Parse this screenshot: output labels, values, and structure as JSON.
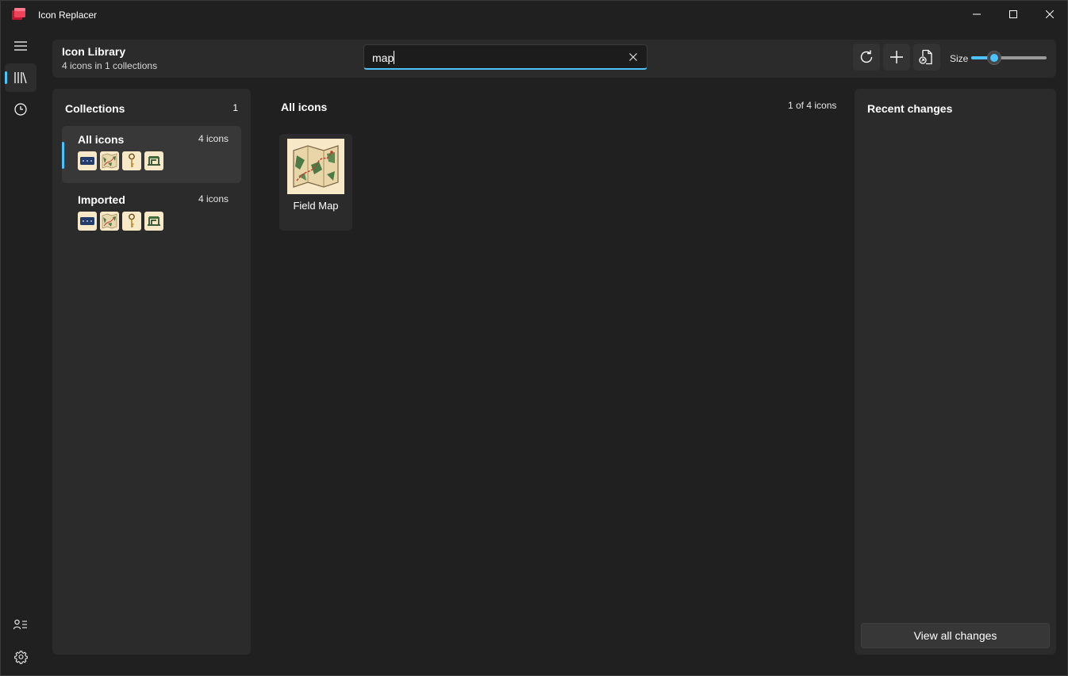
{
  "window": {
    "title": "Icon Replacer"
  },
  "header": {
    "title": "Icon Library",
    "subtitle": "4 icons in 1 collections",
    "search": {
      "value": "map",
      "placeholder": ""
    },
    "size_label": "Size",
    "size_level_percent": 30
  },
  "collections": {
    "title": "Collections",
    "count": "1",
    "items": [
      {
        "name": "All icons",
        "count": "4 icons",
        "selected": true,
        "thumbs": [
          "keyboard-thumb",
          "map-thumb",
          "key-thumb",
          "sewing-machine-thumb"
        ]
      },
      {
        "name": "Imported",
        "count": "4 icons",
        "selected": false,
        "thumbs": [
          "keyboard-thumb",
          "map-thumb",
          "key-thumb",
          "sewing-machine-thumb"
        ]
      }
    ]
  },
  "main": {
    "title": "All icons",
    "count": "1 of 4 icons",
    "icons": [
      {
        "label": "Field Map",
        "icon": "field-map-icon"
      }
    ]
  },
  "recent": {
    "title": "Recent changes",
    "view_all_label": "View all changes"
  },
  "colors": {
    "accent": "#4cc2ff",
    "background": "#202020",
    "panel": "#2b2b2b",
    "thumb_bg": "#f7e9c8"
  }
}
